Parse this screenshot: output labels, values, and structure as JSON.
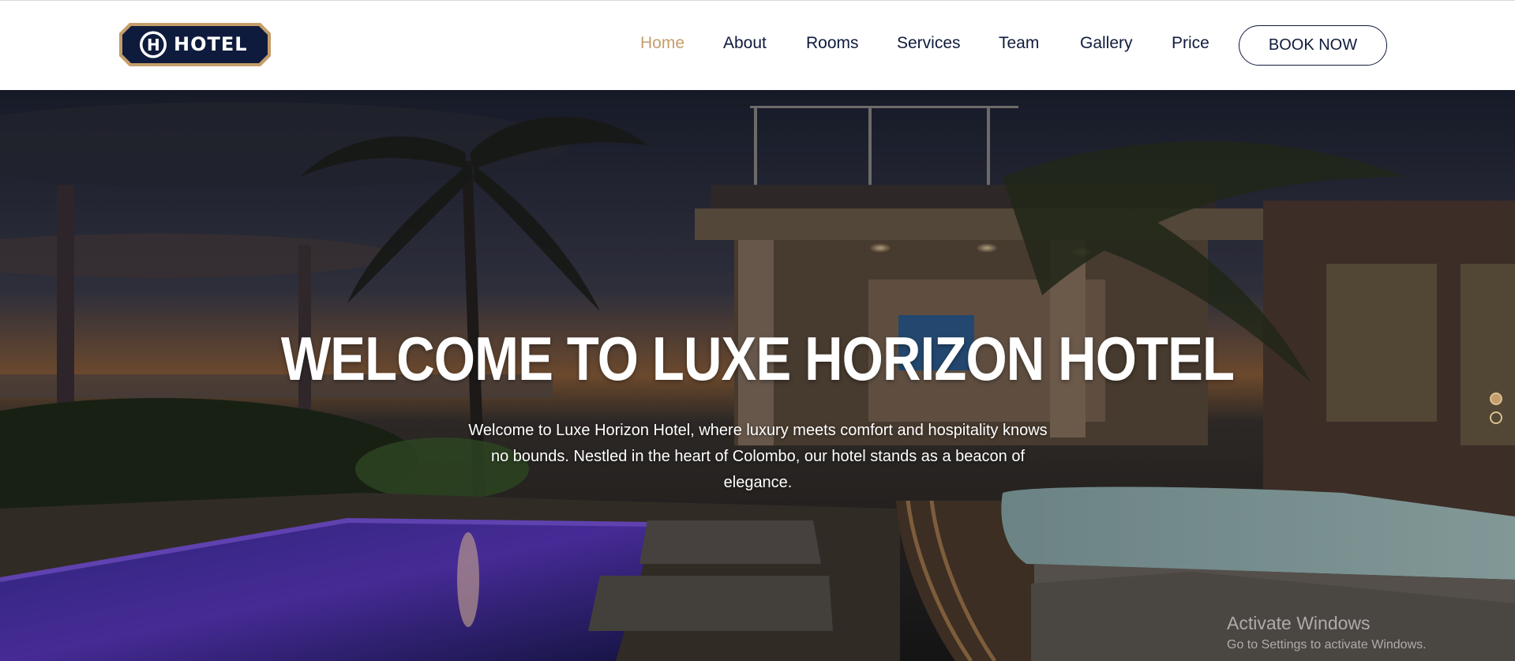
{
  "logo": {
    "text": "HOTEL",
    "letter": "H"
  },
  "nav": {
    "items": [
      {
        "label": "Home",
        "active": true
      },
      {
        "label": "About",
        "active": false
      },
      {
        "label": "Rooms",
        "active": false
      },
      {
        "label": "Services",
        "active": false
      },
      {
        "label": "Team",
        "active": false
      },
      {
        "label": "Gallery",
        "active": false
      },
      {
        "label": "Price",
        "active": false
      }
    ],
    "book_label": "BOOK NOW"
  },
  "hero": {
    "title": "WELCOME TO LUXE HORIZON HOTEL",
    "description": "Welcome to Luxe Horizon Hotel, where luxury meets comfort and hospitality knows no bounds. Nestled in the heart of Colombo, our hotel stands as a beacon of elegance."
  },
  "slider": {
    "dots": 2,
    "active_index": 0
  },
  "watermark": {
    "title": "Activate Windows",
    "subtitle": "Go to Settings to activate Windows."
  },
  "colors": {
    "accent": "#c59d6b",
    "navy": "#0f1b3c",
    "white": "#ffffff"
  }
}
